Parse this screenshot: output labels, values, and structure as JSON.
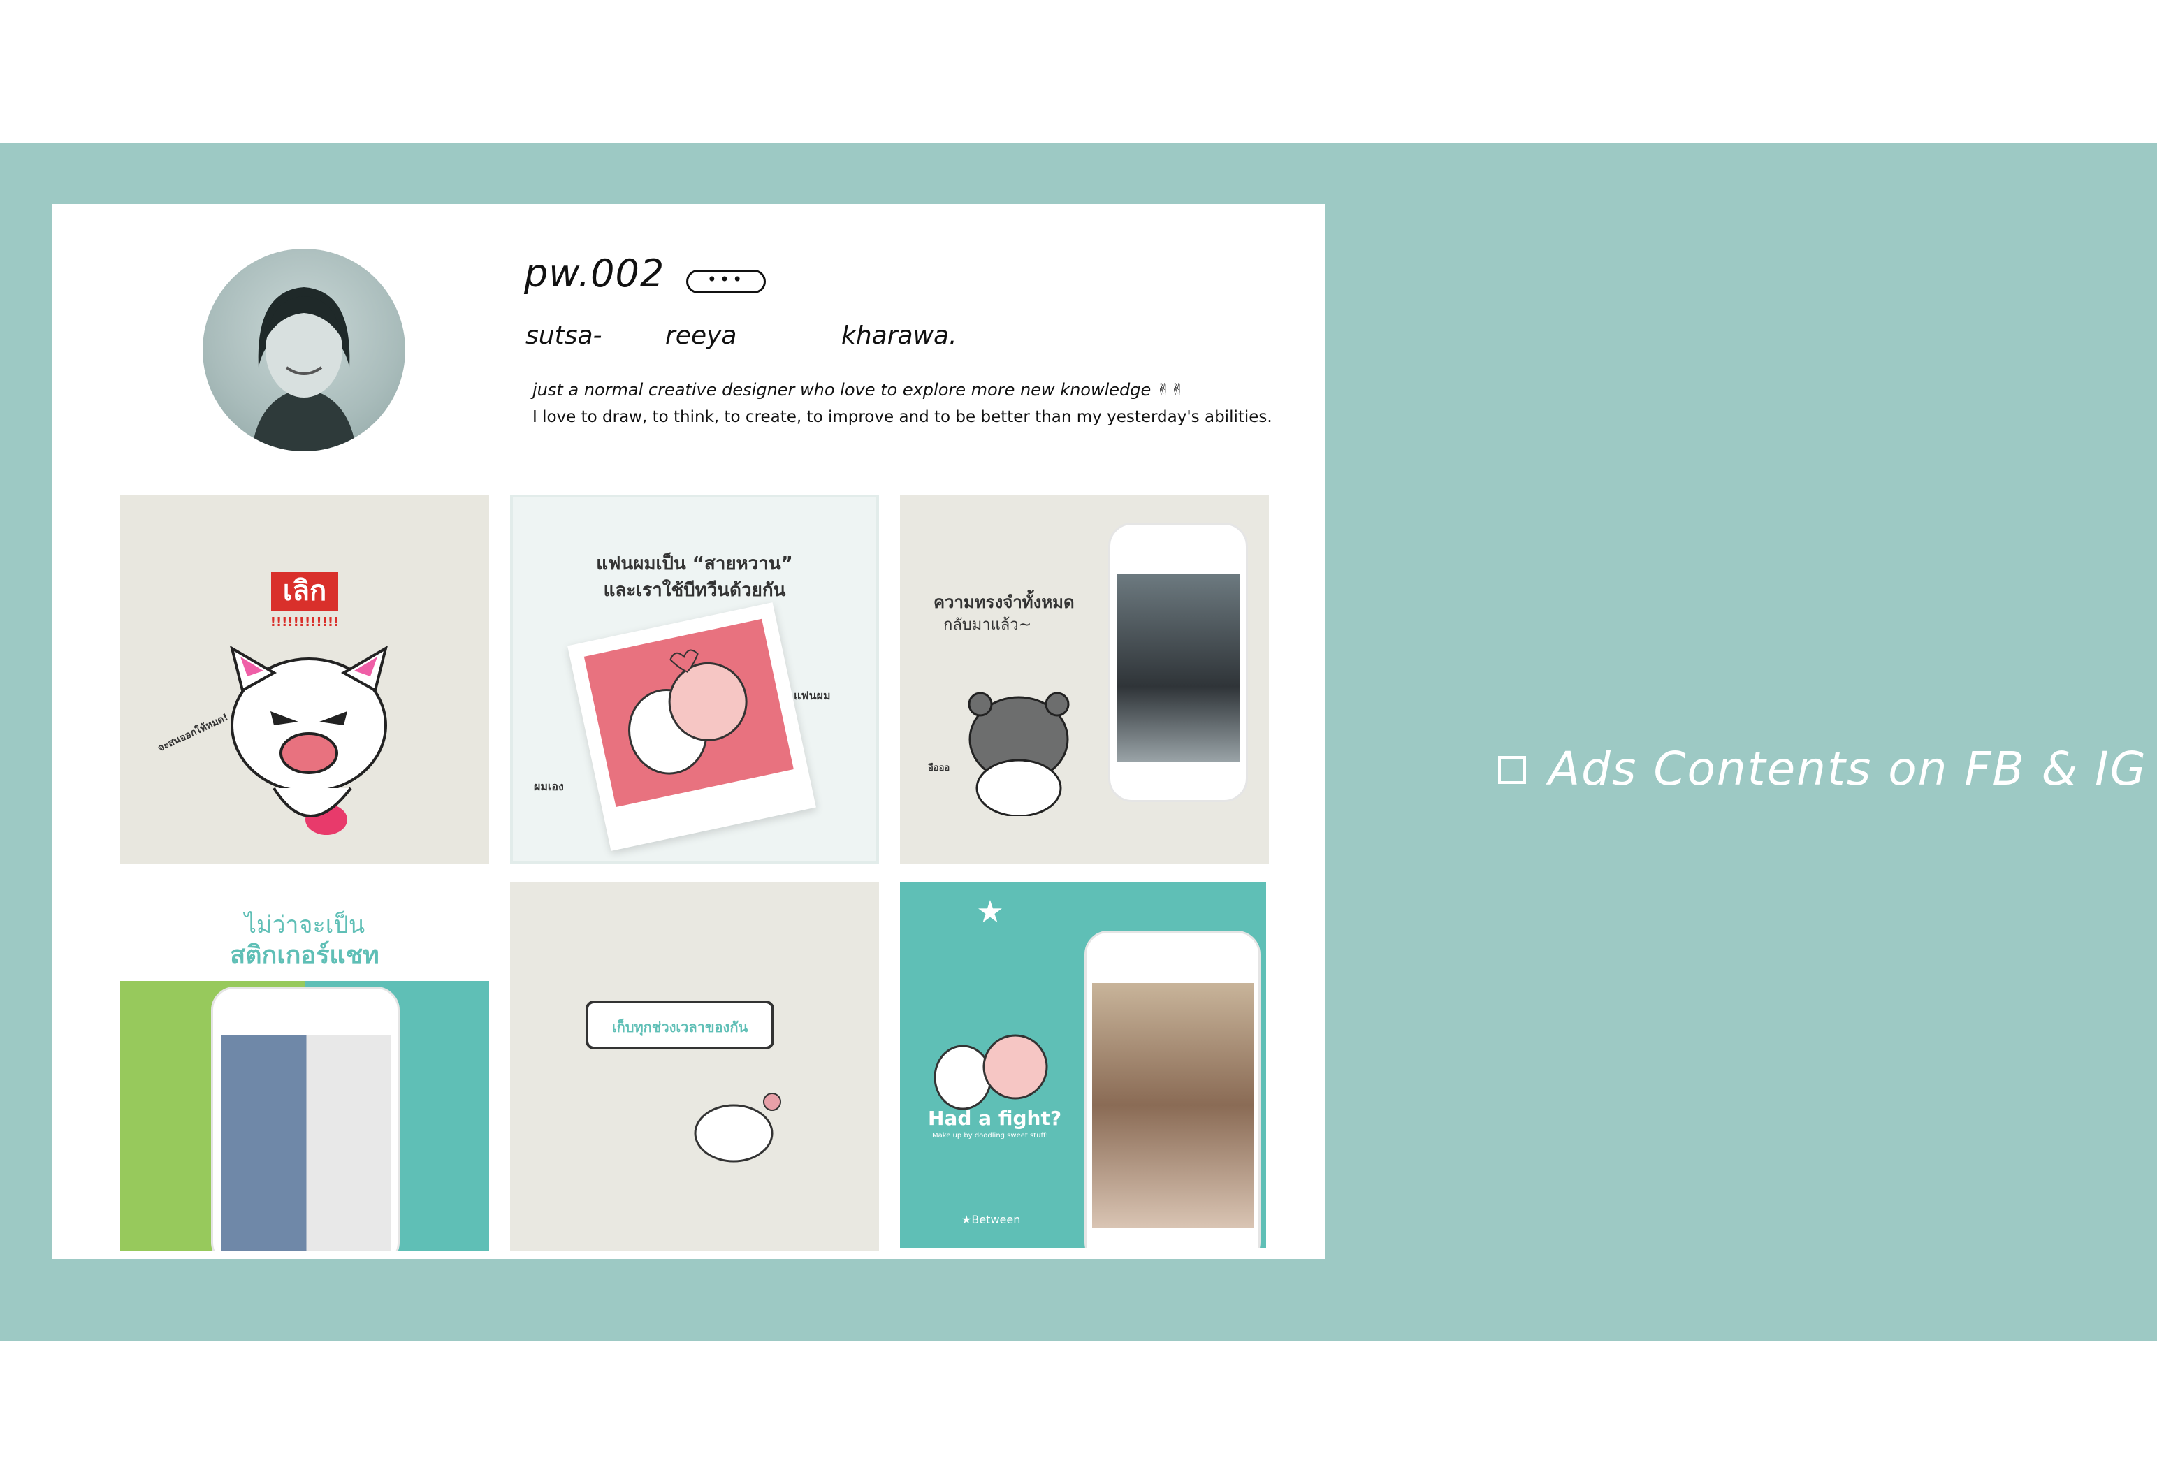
{
  "profile": {
    "username": "pw.002",
    "more_label": "•••",
    "name_parts": [
      "sutsa-",
      "reeya",
      "kharawa."
    ],
    "bio_line1": "just a normal creative designer who love to explore more new knowledge ✌✌",
    "bio_line2": "I love to draw, to think, to create, to improve and to be better than my yesterday's abilities."
  },
  "posts": [
    {
      "text": "เลิก",
      "subtext": "!!!!!!!!!!!!",
      "side_text": "จะสนออกให้หมด!"
    },
    {
      "title_line1": "แฟนผมเป็น “สายหวาน”",
      "title_line2": "และเราใช้บีทวีนด้วยกัน",
      "label_left": "ผมเอง",
      "label_right": "แฟนผม"
    },
    {
      "title_line1": "ความทรงจำทั้งหมด",
      "title_line2": "กลับมาแล้ว~",
      "side_text": "อือออ"
    },
    {
      "title_line1": "ไม่ว่าจะเป็น",
      "title_line2": "สติกเกอร์แชท"
    },
    {
      "bubble": "เก็บทุกช่วงเวลาของกัน"
    },
    {
      "headline": "Had a fight?",
      "subline": "Make up by doodling sweet stuff!",
      "brand": "★Between"
    }
  ],
  "caption": "Ads Contents on FB & IG",
  "colors": {
    "band": "#9dc9c4",
    "teal": "#5fbfb6",
    "pink": "#e8727f"
  }
}
